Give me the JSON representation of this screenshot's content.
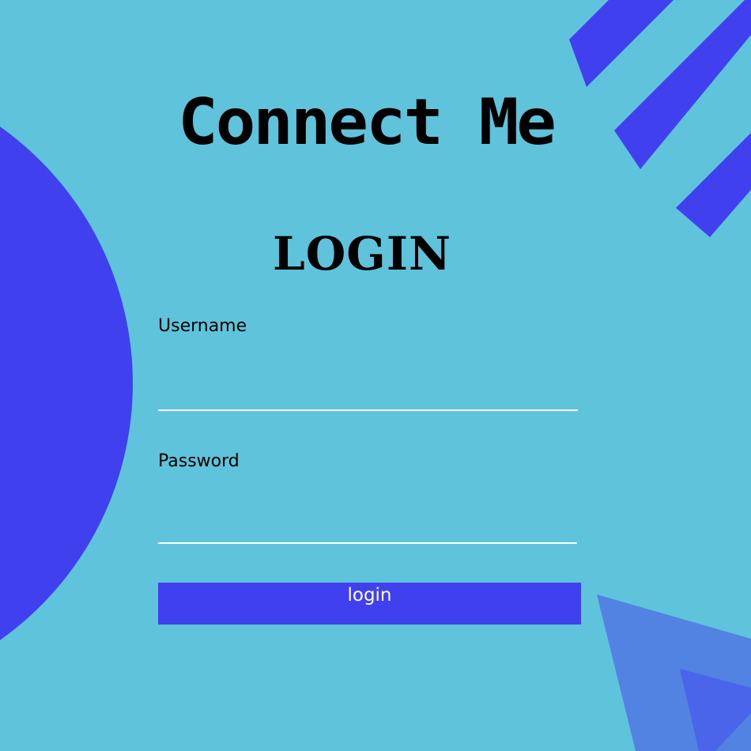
{
  "app": {
    "title": "Connect Me"
  },
  "form": {
    "heading": "LOGIN",
    "username_label": "Username",
    "username_value": "",
    "username_placeholder": "",
    "password_label": "Password",
    "password_value": "",
    "password_placeholder": "",
    "submit_label": "login"
  },
  "theme": {
    "background": "#5fc4db",
    "accent": "#4040ef",
    "accent_light": "#5283e3",
    "accent_mid": "#4a64ea",
    "text": "#000000",
    "underline": "#ffffff"
  }
}
